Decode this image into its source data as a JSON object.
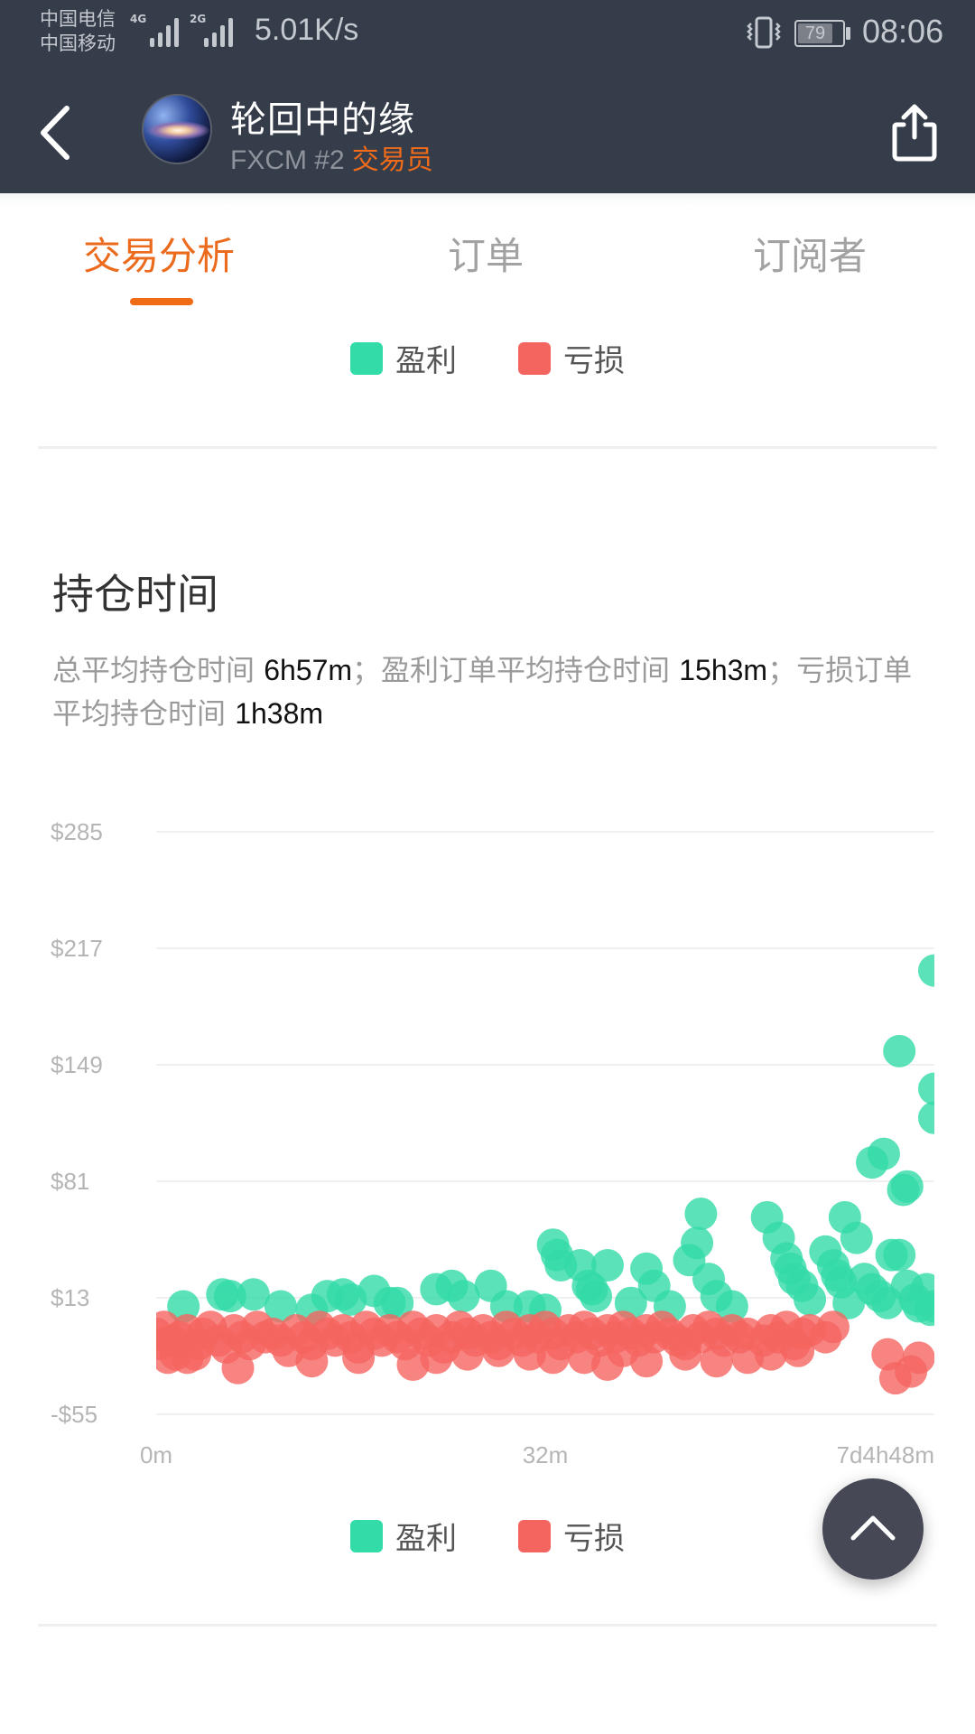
{
  "status_bar": {
    "carrier_1": "中国电信",
    "carrier_2": "中国移动",
    "signal_1_tag": "4G",
    "signal_2_tag": "2G",
    "net_speed": "5.01K/s",
    "battery": "79",
    "time": "08:06"
  },
  "header": {
    "title": "轮回中的缘",
    "broker": "FXCM #2",
    "role": "交易员",
    "back_icon": "chevron-left-icon",
    "share_icon": "share-icon"
  },
  "tabs": [
    {
      "label": "交易分析",
      "active": true
    },
    {
      "label": "订单",
      "active": false
    },
    {
      "label": "订阅者",
      "active": false
    }
  ],
  "legend": {
    "profit_label": "盈利",
    "loss_label": "亏损",
    "profit_color": "#33dba8",
    "loss_color": "#f56560"
  },
  "section": {
    "title": "持仓时间",
    "summary_1": "总平均持仓时间 ",
    "avg_all": "6h57m",
    "summary_2": "；盈利订单平均持仓时间 ",
    "avg_profit": "15h3m",
    "summary_3": "；亏损订单平均持仓时间 ",
    "avg_loss": "1h38m"
  },
  "chart_data": {
    "type": "scatter",
    "title": "持仓时间",
    "xlabel": "",
    "ylabel": "",
    "x_scale": "ordinal-normalized (0 = 0m, 0.5 = 32m, 1 = 7d4h48m)",
    "x_ticks": [
      "0m",
      "32m",
      "7d4h48m"
    ],
    "y_ticks": [
      "$285",
      "$217",
      "$149",
      "$81",
      "$13",
      "-$55"
    ],
    "y_tick_values": [
      285,
      217,
      149,
      81,
      13,
      -55
    ],
    "ylim": [
      -55,
      285
    ],
    "xlim": [
      0,
      1
    ],
    "grid": true,
    "legend_position": "bottom",
    "series": [
      {
        "name": "盈利",
        "color": "#33dba8",
        "points": [
          [
            0.035,
            8
          ],
          [
            0.085,
            15
          ],
          [
            0.095,
            14
          ],
          [
            0.125,
            15
          ],
          [
            0.16,
            8
          ],
          [
            0.2,
            6
          ],
          [
            0.22,
            14
          ],
          [
            0.24,
            15
          ],
          [
            0.25,
            12
          ],
          [
            0.28,
            17
          ],
          [
            0.3,
            10
          ],
          [
            0.31,
            10
          ],
          [
            0.36,
            18
          ],
          [
            0.38,
            20
          ],
          [
            0.395,
            14
          ],
          [
            0.43,
            20
          ],
          [
            0.45,
            8
          ],
          [
            0.48,
            8
          ],
          [
            0.5,
            6
          ],
          [
            0.51,
            44
          ],
          [
            0.515,
            38
          ],
          [
            0.52,
            32
          ],
          [
            0.545,
            32
          ],
          [
            0.555,
            20
          ],
          [
            0.56,
            18
          ],
          [
            0.565,
            14
          ],
          [
            0.58,
            32
          ],
          [
            0.61,
            10
          ],
          [
            0.63,
            30
          ],
          [
            0.64,
            20
          ],
          [
            0.66,
            8
          ],
          [
            0.685,
            35
          ],
          [
            0.695,
            45
          ],
          [
            0.7,
            62
          ],
          [
            0.71,
            24
          ],
          [
            0.72,
            14
          ],
          [
            0.74,
            8
          ],
          [
            0.785,
            60
          ],
          [
            0.8,
            48
          ],
          [
            0.81,
            36
          ],
          [
            0.815,
            30
          ],
          [
            0.82,
            24
          ],
          [
            0.83,
            20
          ],
          [
            0.84,
            12
          ],
          [
            0.86,
            40
          ],
          [
            0.87,
            32
          ],
          [
            0.875,
            26
          ],
          [
            0.88,
            22
          ],
          [
            0.89,
            10
          ],
          [
            0.885,
            60
          ],
          [
            0.9,
            48
          ],
          [
            0.91,
            24
          ],
          [
            0.92,
            18
          ],
          [
            0.93,
            14
          ],
          [
            0.94,
            10
          ],
          [
            0.945,
            38
          ],
          [
            0.955,
            38
          ],
          [
            0.965,
            20
          ],
          [
            0.975,
            12
          ],
          [
            0.98,
            8
          ],
          [
            0.99,
            18
          ],
          [
            0.995,
            6
          ],
          [
            1.0,
            8
          ],
          [
            0.92,
            92
          ],
          [
            0.935,
            97
          ],
          [
            0.96,
            76
          ],
          [
            0.965,
            78
          ],
          [
            0.955,
            157
          ],
          [
            1.0,
            135
          ],
          [
            1.0,
            118
          ],
          [
            1.0,
            204
          ]
        ]
      },
      {
        "name": "亏损",
        "color": "#f56560",
        "points": [
          [
            0.0,
            -8
          ],
          [
            0.005,
            -14
          ],
          [
            0.01,
            -4
          ],
          [
            0.02,
            -12
          ],
          [
            0.025,
            -20
          ],
          [
            0.03,
            -10
          ],
          [
            0.04,
            -6
          ],
          [
            0.05,
            -20
          ],
          [
            0.055,
            -14
          ],
          [
            0.06,
            -8
          ],
          [
            0.07,
            -4
          ],
          [
            0.08,
            -12
          ],
          [
            0.09,
            -16
          ],
          [
            0.1,
            -6
          ],
          [
            0.11,
            -10
          ],
          [
            0.12,
            -14
          ],
          [
            0.13,
            -4
          ],
          [
            0.14,
            -10
          ],
          [
            0.15,
            -8
          ],
          [
            0.16,
            -12
          ],
          [
            0.17,
            -18
          ],
          [
            0.18,
            -6
          ],
          [
            0.19,
            -10
          ],
          [
            0.2,
            -14
          ],
          [
            0.21,
            -4
          ],
          [
            0.22,
            -8
          ],
          [
            0.23,
            -12
          ],
          [
            0.24,
            -6
          ],
          [
            0.25,
            -10
          ],
          [
            0.26,
            -16
          ],
          [
            0.27,
            -4
          ],
          [
            0.28,
            -8
          ],
          [
            0.29,
            -12
          ],
          [
            0.3,
            -6
          ],
          [
            0.31,
            -10
          ],
          [
            0.32,
            -14
          ],
          [
            0.33,
            -4
          ],
          [
            0.34,
            -8
          ],
          [
            0.35,
            -12
          ],
          [
            0.36,
            -6
          ],
          [
            0.37,
            -16
          ],
          [
            0.38,
            -10
          ],
          [
            0.39,
            -4
          ],
          [
            0.4,
            -8
          ],
          [
            0.41,
            -12
          ],
          [
            0.42,
            -6
          ],
          [
            0.43,
            -10
          ],
          [
            0.44,
            -14
          ],
          [
            0.45,
            -4
          ],
          [
            0.46,
            -8
          ],
          [
            0.47,
            -12
          ],
          [
            0.48,
            -6
          ],
          [
            0.49,
            -10
          ],
          [
            0.5,
            -4
          ],
          [
            0.51,
            -8
          ],
          [
            0.52,
            -14
          ],
          [
            0.53,
            -6
          ],
          [
            0.54,
            -10
          ],
          [
            0.55,
            -4
          ],
          [
            0.56,
            -8
          ],
          [
            0.57,
            -12
          ],
          [
            0.58,
            -6
          ],
          [
            0.59,
            -10
          ],
          [
            0.6,
            -4
          ],
          [
            0.61,
            -8
          ],
          [
            0.62,
            -12
          ],
          [
            0.63,
            -6
          ],
          [
            0.64,
            -10
          ],
          [
            0.65,
            -4
          ],
          [
            0.66,
            -8
          ],
          [
            0.67,
            -12
          ],
          [
            0.68,
            -14
          ],
          [
            0.69,
            -6
          ],
          [
            0.7,
            -10
          ],
          [
            0.71,
            -4
          ],
          [
            0.72,
            -8
          ],
          [
            0.73,
            -12
          ],
          [
            0.74,
            -6
          ],
          [
            0.75,
            -10
          ],
          [
            0.76,
            -8
          ],
          [
            0.78,
            -12
          ],
          [
            0.79,
            -6
          ],
          [
            0.8,
            -10
          ],
          [
            0.81,
            -4
          ],
          [
            0.82,
            -14
          ],
          [
            0.83,
            -8
          ],
          [
            0.84,
            -6
          ],
          [
            0.86,
            -10
          ],
          [
            0.87,
            -4
          ],
          [
            0.015,
            -22
          ],
          [
            0.04,
            -22
          ],
          [
            0.105,
            -28
          ],
          [
            0.2,
            -24
          ],
          [
            0.26,
            -22
          ],
          [
            0.33,
            -26
          ],
          [
            0.36,
            -22
          ],
          [
            0.4,
            -20
          ],
          [
            0.44,
            -18
          ],
          [
            0.48,
            -20
          ],
          [
            0.51,
            -22
          ],
          [
            0.55,
            -22
          ],
          [
            0.58,
            -26
          ],
          [
            0.6,
            -18
          ],
          [
            0.63,
            -24
          ],
          [
            0.68,
            -20
          ],
          [
            0.72,
            -24
          ],
          [
            0.76,
            -22
          ],
          [
            0.79,
            -20
          ],
          [
            0.825,
            -18
          ],
          [
            0.94,
            -20
          ],
          [
            0.95,
            -34
          ],
          [
            0.97,
            -30
          ],
          [
            0.98,
            -22
          ]
        ]
      }
    ]
  },
  "fab": {
    "icon": "chevron-up-icon"
  }
}
